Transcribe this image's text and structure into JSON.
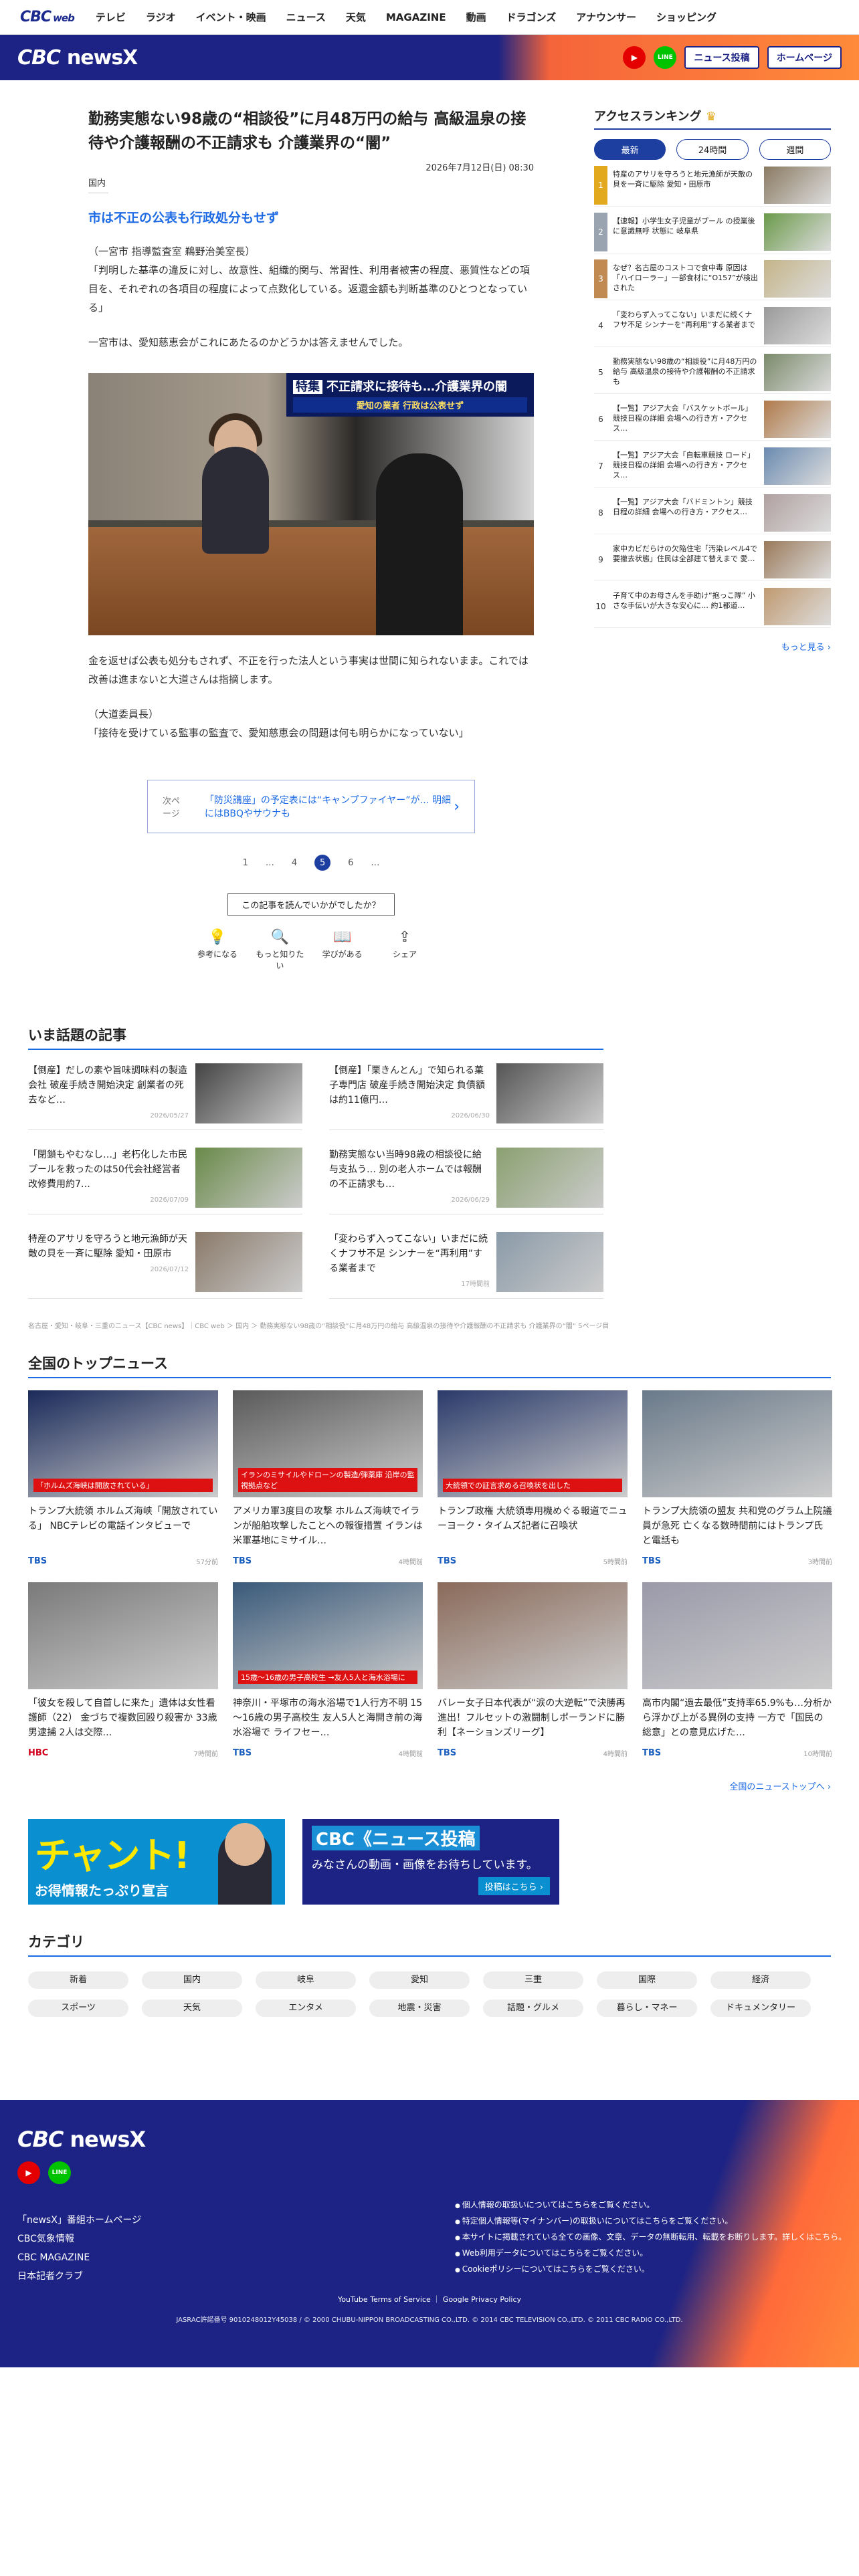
{
  "topnav": {
    "logo": "CBC",
    "logo_sub": "web",
    "items": [
      "テレビ",
      "ラジオ",
      "イベント・映画",
      "ニュース",
      "天気",
      "MAGAZINE",
      "動画",
      "ドラゴンズ",
      "アナウンサー",
      "ショッピング"
    ]
  },
  "brand": {
    "logo": "CBC",
    "logo_sub": "newsX",
    "news_post_label": "ニュース投稿",
    "home_label": "ホームページ",
    "youtube": "▶",
    "line": "LINE"
  },
  "article": {
    "title": "勤務実態ない98歳の“相談役”に月48万円の給与 高級温泉の接待や介護報酬の不正請求も 介護業界の“闇”",
    "date": "2026年7月12日(日) 08:30",
    "category": "国内",
    "subheading": "市は不正の公表も行政処分もせず",
    "para1": "（一宮市 指導監査室 鵜野治美室長）\n「判明した基準の違反に対し、故意性、組織的関与、常習性、利用者被害の程度、悪質性などの項目を、それぞれの各項目の程度によって点数化している。返還金額も判断基準のひとつとなっている」",
    "para2": "一宮市は、愛知慈恵会がこれにあたるのかどうかは答えませんでした。",
    "photo_caption_tag": "特集",
    "photo_caption": "不正請求に接待も…介護業界の闇",
    "photo_caption_sub": "愛知の業者 行政は公表せず",
    "para3": "金を返せば公表も処分もされず、不正を行った法人という事実は世間に知られないまま。これでは改善は進まないと大道さんは指摘します。",
    "para4": "（大道委員長）\n「接待を受けている監事の監査で、愛知慈恵会の問題は何も明らかになっていない」"
  },
  "nextpage": {
    "label": "次ページ",
    "text": "「防災講座」の予定表には“キャンプファイヤー”が… 明細にはBBQやサウナも",
    "chevron": "›"
  },
  "pager": [
    "1",
    "…",
    "4",
    "5",
    "6",
    "…"
  ],
  "feedback": {
    "question": "この記事を読んでいかがでしたか？",
    "options": [
      {
        "icon": "💡",
        "label": "参考になる"
      },
      {
        "icon": "🔍",
        "label": "もっと知りたい"
      },
      {
        "icon": "📖",
        "label": "学びがある"
      },
      {
        "icon": "⇪",
        "label": "シェア"
      }
    ]
  },
  "ranking": {
    "title": "アクセスランキング",
    "tabs": [
      "最新",
      "24時間",
      "週間"
    ],
    "items": [
      {
        "n": "1",
        "t": "特産のアサリを守ろうと地元漁師が天敵の貝を一斉に駆除 愛知・田原市"
      },
      {
        "n": "2",
        "t": "【速報】小学生女子児童がプール の授業後に意識無呼 状態に 岐阜県"
      },
      {
        "n": "3",
        "t": "なぜ？名古屋のコストコで食中毒 原因は「ハイローラー」一部食材に“O157”が検出された"
      },
      {
        "n": "4",
        "t": "「変わらず入ってこない」いまだに続くナフサ不足 シンナーを“再利用”する業者まで"
      },
      {
        "n": "5",
        "t": "勤務実態ない98歳の“相談役”に月48万円の給与 高級温泉の接待や介護報酬の不正請求も"
      },
      {
        "n": "6",
        "t": "【一覧】アジア大会「バスケットボール」競技日程の詳細 会場への行き方・アクセス…"
      },
      {
        "n": "7",
        "t": "【一覧】アジア大会「自転車競技 ロード」競技日程の詳細 会場への行き方・アクセス…"
      },
      {
        "n": "8",
        "t": "【一覧】アジア大会「バドミントン」競技日程の詳細 会場への行き方・アクセス…"
      },
      {
        "n": "9",
        "t": "家中カビだらけの欠陥住宅「汚染レベル4で要撤去状態」住民は全部建て替えまで 愛…"
      },
      {
        "n": "10",
        "t": "子育て中のお母さんを手助け“抱っこ隊” 小さな手伝いが大きな安心に… 約1都道…"
      }
    ],
    "more": "もっと見る ›"
  },
  "trending": {
    "title": "いま話題の記事",
    "items": [
      {
        "t": "【倒産】だしの素や旨味調味料の製造会社 破産手続き開始決定 創業者の死去など…",
        "d": "2026/05/27"
      },
      {
        "t": "【倒産】「栗きんとん」で知られる菓子専門店 破産手続き開始決定 負債額は約11億円…",
        "d": "2026/06/30"
      },
      {
        "t": "「閉鎖もやむなし…」老朽化した市民プールを救ったのは50代会社経営者 改修費用約7…",
        "d": "2026/07/09"
      },
      {
        "t": "勤務実態ない当時98歳の相談役に給与支払う… 別の老人ホームでは報酬の不正請求も…",
        "d": "2026/06/29"
      },
      {
        "t": "特産のアサリを守ろうと地元漁師が天敵の貝を一斉に駆除 愛知・田原市",
        "d": "2026/07/12"
      },
      {
        "t": "「変わらず入ってこない」いまだに続くナフサ不足 シンナーを“再利用”する業者まで",
        "d": "17時間前"
      }
    ]
  },
  "breadcrumb": "名古屋・愛知・岐阜・三重のニュース【CBC news】｜CBC web ＞ 国内 ＞ 勤務実態ない98歳の“相談役”に月48万円の給与 高級温泉の接待や介護報酬の不正請求も 介護業界の“闇” 5ページ目",
  "topnews": {
    "title": "全国のトップニュース",
    "items": [
      {
        "t": "トランプ大統領 ホルムズ海峡「開放されている」 NBCテレビの電話インタビューで",
        "src": "TBS",
        "time": "57分前",
        "caption": "「ホルムズ海峡は開放されている」"
      },
      {
        "t": "アメリカ軍3度目の攻撃 ホルムズ海峡でイランが船舶攻撃したことへの報復措置 イランは米軍基地にミサイル…",
        "src": "TBS",
        "time": "4時間前",
        "caption": "イランのミサイルやドローンの製造/弾薬庫 沿岸の監視拠点など"
      },
      {
        "t": "トランプ政権 大統領専用機めぐる報道でニューヨーク・タイムズ記者に召喚状",
        "src": "TBS",
        "time": "5時間前",
        "caption": "大統領での証言求める召喚状を出した"
      },
      {
        "t": "トランプ大統領の盟友 共和党のグラム上院議員が急死 亡くなる数時間前にはトランプ氏と電話も",
        "src": "TBS",
        "time": "3時間前",
        "caption": ""
      },
      {
        "t": "「彼女を殺して自首しに来た」遺体は女性看護師（22） 金づちで複数回殴り殺害か 33歳男逮捕 2人は交際…",
        "src": "HBC",
        "time": "7時間前",
        "caption": ""
      },
      {
        "t": "神奈川・平塚市の海水浴場で1人行方不明 15～16歳の男子高校生 友人5人と海開き前の海水浴場で ライフセー…",
        "src": "TBS",
        "time": "4時間前",
        "caption": "15歳～16歳の男子高校生 →友人5人と海水浴場に"
      },
      {
        "t": "バレー女子日本代表が“涙の大逆転”で決勝再進出！フルセットの激闘制しポーランドに勝利【ネーションズリーグ】",
        "src": "TBS",
        "time": "4時間前",
        "caption": ""
      },
      {
        "t": "高市内閣“過去最低”支持率65.9%も…分析から浮かび上がる異例の支持 一方で「国民の総意」との意見広げた…",
        "src": "TBS",
        "time": "10時間前",
        "caption": ""
      }
    ],
    "more": "全国のニューストップへ ›"
  },
  "banners": {
    "b1_big": "チャント!",
    "b1_small": "お得情報たっぷり宣言",
    "b2_head": "CBC《ニュース投稿",
    "b2_text": "みなさんの動画・画像をお待ちしています。",
    "b2_btn": "投稿はこちら ›"
  },
  "category": {
    "title": "カテゴリ",
    "items": [
      "新着",
      "国内",
      "岐阜",
      "愛知",
      "三重",
      "国際",
      "経済",
      "スポーツ",
      "天気",
      "エンタメ",
      "地震・災害",
      "話題・グルメ",
      "暮らし・マネー",
      "ドキュメンタリー"
    ]
  },
  "footer": {
    "logo": "CBC",
    "logo_sub": "newsX",
    "links": [
      "「newsX」番組ホームページ",
      "CBC気象情報",
      "CBC MAGAZINE",
      "日本記者クラブ"
    ],
    "rlinks": [
      "個人情報の取扱いについてはこちらをご覧ください。",
      "特定個人情報等(マイナンバー)の取扱いについてはこちらをご覧ください。",
      "本サイトに掲載されている全ての画像、文章、データの無断転用、転載をお断りします。詳しくはこちら。",
      "Web利用データについてはこちらをご覧ください。",
      "Cookieポリシーについてはこちらをご覧ください。"
    ],
    "bottom": "YouTube Terms of Service ｜ Google Privacy Policy",
    "copy": "JASRAC許諾番号 9010248012Y45038 / © 2000 CHUBU-NIPPON BROADCASTING CO.,LTD. © 2014 CBC TELEVISION CO.,LTD. © 2011 CBC RADIO CO.,LTD."
  }
}
